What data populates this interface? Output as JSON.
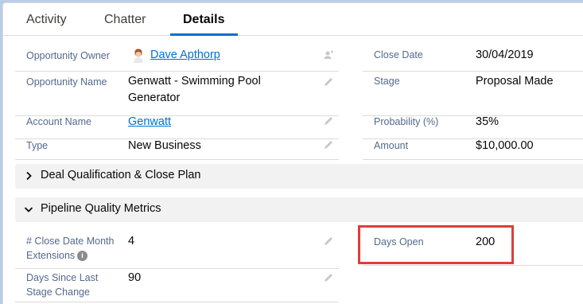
{
  "tabs": [
    {
      "label": "Activity"
    },
    {
      "label": "Chatter"
    },
    {
      "label": "Details",
      "active": true
    }
  ],
  "fields": {
    "opportunity_owner": {
      "label": "Opportunity Owner",
      "value": "Dave Apthorp"
    },
    "opportunity_name": {
      "label": "Opportunity Name",
      "value_line1": "Genwatt - Swimming Pool",
      "value_line2": "Generator"
    },
    "account_name": {
      "label": "Account Name",
      "value": "Genwatt"
    },
    "type": {
      "label": "Type",
      "value": "New Business"
    },
    "close_date": {
      "label": "Close Date",
      "value": "30/04/2019"
    },
    "stage": {
      "label": "Stage",
      "value": "Proposal Made"
    },
    "probability": {
      "label": "Probability (%)",
      "value": "35%"
    },
    "amount": {
      "label": "Amount",
      "value": "$10,000.00"
    }
  },
  "sections": [
    {
      "title": "Deal Qualification & Close Plan",
      "expanded": false
    },
    {
      "title": "Pipeline Quality Metrics",
      "expanded": true
    }
  ],
  "pipeline": {
    "close_date_ext": {
      "label_line1": "# Close Date Month",
      "label_line2": "Extensions",
      "value": "4"
    },
    "days_since_stage": {
      "label_line1": "Days Since Last",
      "label_line2": "Stage Change",
      "value": "90"
    },
    "days_open": {
      "label": "Days Open",
      "value": "200"
    }
  },
  "colors": {
    "link": "#0070d2",
    "highlight": "#e03c3c",
    "section_bg": "#f3f2f2"
  }
}
